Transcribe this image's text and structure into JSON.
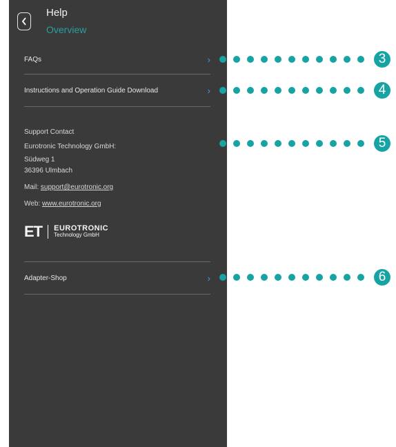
{
  "header": {
    "title": "Help",
    "subtitle": "Overview"
  },
  "menu": {
    "faqs": "FAQs",
    "instructions": "Instructions and Operation Guide Download",
    "adapter_shop": "Adapter-Shop"
  },
  "support": {
    "heading": "Support Contact",
    "company": "Eurotronic Technology GmbH:",
    "street": "Südweg 1",
    "city": "36396 Ulmbach",
    "mail_label": "Mail:",
    "mail_value": "support@eurotronic.org",
    "web_label": "Web:",
    "web_value": "www.eurotronic.org"
  },
  "logo": {
    "mark": "ET",
    "name": "EUROTRONIC",
    "tagline": "Technology GmbH"
  },
  "callouts": {
    "c3": "3",
    "c4": "4",
    "c5": "5",
    "c6": "6"
  },
  "colors": {
    "panel": "#3a3a3a",
    "accent": "#17a3a3",
    "chevron": "#3aa6c8"
  }
}
